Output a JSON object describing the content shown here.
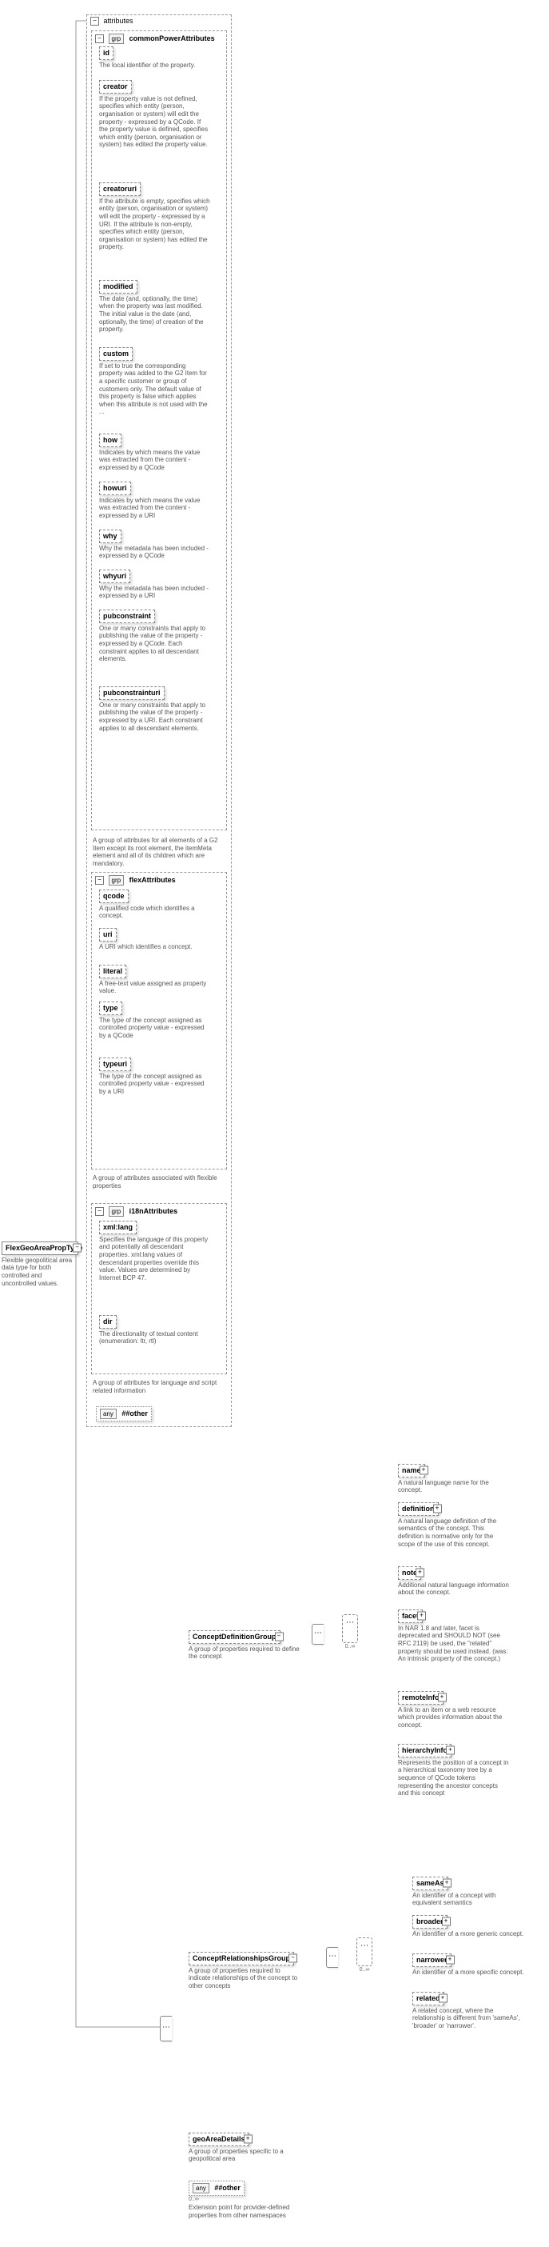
{
  "root": {
    "name": "FlexGeoAreaPropType",
    "desc": "Flexible geopolitical area data type for both controlled and uncontrolled values."
  },
  "attributes_label": "attributes",
  "groups": {
    "commonPower": {
      "grp": "grp",
      "title": "commonPowerAttributes",
      "desc": "A group of attributes for all elements of a G2 Item except its root element, the itemMeta element and all of its children which are mandatory.",
      "attrs": [
        {
          "name": "id",
          "desc": "The local identifier of the property."
        },
        {
          "name": "creator",
          "desc": "If the property value is not defined, specifies which entity (person, organisation or system) will edit the property - expressed by a QCode. If the property value is defined, specifies which entity (person, organisation or system) has edited the property value."
        },
        {
          "name": "creatoruri",
          "desc": "If the attribute is empty, specifies which entity (person, organisation or system) will edit the property - expressed by a URI. If the attribute is non-empty, specifies which entity (person, organisation or system) has edited the property."
        },
        {
          "name": "modified",
          "desc": "The date (and, optionally, the time) when the property was last modified. The initial value is the date (and, optionally, the time) of creation of the property."
        },
        {
          "name": "custom",
          "desc": "If set to true the corresponding property was added to the G2 Item for a specific customer or group of customers only. The default value of this property is false which applies when this attribute is not used with the ..."
        },
        {
          "name": "how",
          "desc": "Indicates by which means the value was extracted from the content - expressed by a QCode"
        },
        {
          "name": "howuri",
          "desc": "Indicates by which means the value was extracted from the content - expressed by a URI"
        },
        {
          "name": "why",
          "desc": "Why the metadata has been included - expressed by a QCode"
        },
        {
          "name": "whyuri",
          "desc": "Why the metadata has been included - expressed by a URI"
        },
        {
          "name": "pubconstraint",
          "desc": "One or many constraints that apply to publishing the value of the property - expressed by a QCode. Each constraint applies to all descendant elements."
        },
        {
          "name": "pubconstrainturi",
          "desc": "One or many constraints that apply to publishing the value of the property - expressed by a URI. Each constraint applies to all descendant elements."
        }
      ]
    },
    "flex": {
      "grp": "grp",
      "title": "flexAttributes",
      "desc": "A group of attributes associated with flexible properties",
      "attrs": [
        {
          "name": "qcode",
          "desc": "A qualified code which identifies a concept."
        },
        {
          "name": "uri",
          "desc": "A URI which identifies a concept."
        },
        {
          "name": "literal",
          "desc": "A free-text value assigned as property value."
        },
        {
          "name": "type",
          "desc": "The type of the concept assigned as controlled property value - expressed by a QCode"
        },
        {
          "name": "typeuri",
          "desc": "The type of the concept assigned as controlled property value - expressed by a URI"
        }
      ]
    },
    "i18n": {
      "grp": "grp",
      "title": "i18nAttributes",
      "desc": "A group of attributes for language and script related information",
      "attrs": [
        {
          "name": "xml:lang",
          "desc": "Specifies the language of this property and potentially all descendant properties. xml:lang values of descendant properties override this value. Values are determined by Internet BCP 47."
        },
        {
          "name": "dir",
          "desc": "The directionality of textual content (enumeration: ltr, rtl)"
        }
      ]
    }
  },
  "other_attr": {
    "prefix": "any",
    "name": "##other"
  },
  "conceptDef": {
    "name": "ConceptDefinitionGroup",
    "desc": "A group of properties required to define the concept",
    "multi": "0..∞",
    "children": [
      {
        "name": "name",
        "desc": "A natural language name for the concept."
      },
      {
        "name": "definition",
        "desc": "A natural language definition of the semantics of the concept. This definition is normative only for the scope of the use of this concept."
      },
      {
        "name": "note",
        "desc": "Additional natural language information about the concept."
      },
      {
        "name": "facet",
        "desc": "In NAR 1.8 and later, facet is deprecated and SHOULD NOT (see RFC 2119) be used, the \"related\" property should be used instead. (was: An intrinsic property of the concept.)"
      },
      {
        "name": "remoteInfo",
        "desc": "A link to an item or a web resource which provides information about the concept."
      },
      {
        "name": "hierarchyInfo",
        "desc": "Represents the position of a concept in a hierarchical taxonomy tree by a sequence of QCode tokens representing the ancestor concepts and this concept"
      }
    ]
  },
  "conceptRel": {
    "name": "ConceptRelationshipsGroup",
    "desc": "A group of properties required to indicate relationships of the concept to other concepts",
    "multi": "0..∞",
    "children": [
      {
        "name": "sameAs",
        "desc": "An identifier of a concept with equivalent semantics"
      },
      {
        "name": "broader",
        "desc": "An identifier of a more generic concept."
      },
      {
        "name": "narrower",
        "desc": "An identifier of a more specific concept."
      },
      {
        "name": "related",
        "desc": "A related concept, where the relationship is different from 'sameAs', 'broader' or 'narrower'."
      }
    ]
  },
  "geoArea": {
    "name": "geoAreaDetails",
    "desc": "A group of properties specific to a geopolitical area"
  },
  "anyOther": {
    "prefix": "any",
    "name": "##other",
    "desc": "Extension point for provider-defined properties from other namespaces",
    "multi": "0..∞"
  }
}
